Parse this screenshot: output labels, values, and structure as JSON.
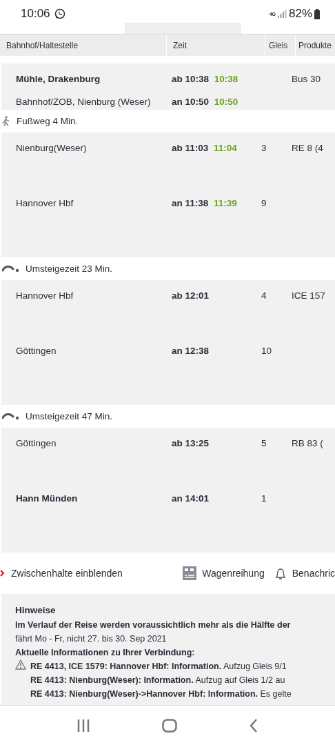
{
  "status_bar": {
    "time": "10:06",
    "network": "4G",
    "battery": "82%"
  },
  "table": {
    "columns": [
      "Bahnhof/Haltestelle",
      "Zeit",
      "Gleis",
      "Produkte"
    ],
    "segments": [
      {
        "kind": "leg",
        "compact": true,
        "stops": [
          {
            "station": "Mühle, Drakenburg",
            "highlighted": true,
            "time": "ab 10:38",
            "realtime": "10:38",
            "product": "Bus 30"
          },
          {
            "station": "Bahnhof/ZOB, Nienburg (Weser)",
            "highlighted": false,
            "time": "an 10:50",
            "realtime": "10:50"
          }
        ]
      },
      {
        "kind": "walk",
        "text": "Fußweg 4 Min."
      },
      {
        "kind": "leg",
        "compact": false,
        "stops": [
          {
            "station": "Nienburg(Weser)",
            "highlighted": false,
            "time": "ab 11:03",
            "realtime": "11:04",
            "platform": "3",
            "product": "RE 8 (4"
          },
          {
            "station": "Hannover Hbf",
            "highlighted": false,
            "time": "an 11:38",
            "realtime": "11:39",
            "platform": "9"
          }
        ]
      },
      {
        "kind": "transfer",
        "text": "Umsteigezeit 23 Min."
      },
      {
        "kind": "leg",
        "compact": false,
        "stops": [
          {
            "station": "Hannover Hbf",
            "highlighted": false,
            "time": "ab 12:01",
            "platform": "4",
            "product": "ICE 157"
          },
          {
            "station": "Göttingen",
            "highlighted": false,
            "time": "an 12:38",
            "platform": "10"
          }
        ]
      },
      {
        "kind": "transfer",
        "text": "Umsteigezeit 47 Min."
      },
      {
        "kind": "leg",
        "compact": false,
        "stops": [
          {
            "station": "Göttingen",
            "highlighted": false,
            "time": "ab 13:25",
            "platform": "5",
            "product": "RB 83 ("
          },
          {
            "station": "Hann Münden",
            "highlighted": true,
            "time": "an 14:01",
            "platform": "1"
          }
        ]
      }
    ]
  },
  "actions": [
    {
      "kind": "expand",
      "label": "Zwischenhalte einblenden"
    },
    {
      "kind": "coaches",
      "label": "Wagenreihung"
    },
    {
      "kind": "bell",
      "label": "Benachric"
    }
  ],
  "notes": {
    "title": "Hinweise",
    "lines": [
      {
        "kind": "bold",
        "text": "Im Verlauf der Reise werden voraussichtlich mehr als die Hälfte der"
      },
      {
        "kind": "plain",
        "text": "fährt Mo - Fr, nicht 27. bis 30. Sep 2021"
      },
      {
        "kind": "bold",
        "text": "Aktuelle Informationen zu Ihrer Verbindung:"
      }
    ],
    "messages": [
      {
        "text": "**RE 4413, ICE 1579: Hannover Hbf: Information.** Aufzug Gleis 9/1"
      },
      {
        "text": "**RE 4413: Nienburg(Weser): Information.** Aufzug auf Gleis 1/2 au"
      },
      {
        "text": "**RE 4413: Nienburg(Weser)->Hannover Hbf: Information.** Es gelte"
      }
    ]
  }
}
